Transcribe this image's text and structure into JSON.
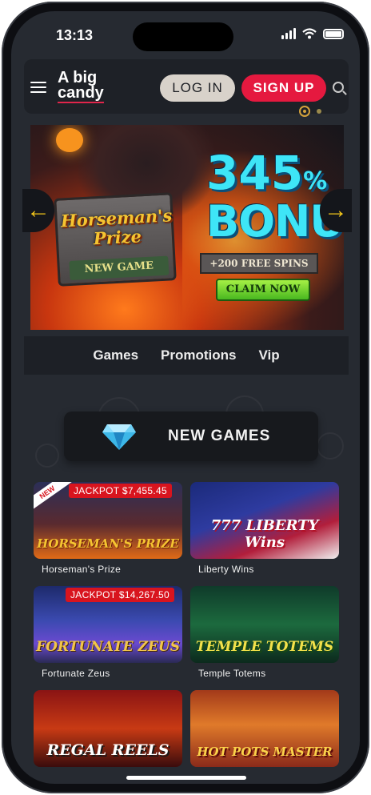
{
  "status_bar": {
    "time": "13:13"
  },
  "header": {
    "logo_line1": "A big",
    "logo_line2": "candy",
    "login_label": "LOG IN",
    "signup_label": "SIGN UP"
  },
  "banner": {
    "game_title": "Horseman's Prize",
    "game_tag": "NEW GAME",
    "bonus_percent": "345",
    "bonus_percent_sign": "%",
    "bonus_word": "BONUS",
    "free_spins": "+200 FREE SPINS",
    "cta_label": "CLAIM NOW",
    "arrow_left_glyph": "←",
    "arrow_right_glyph": "→"
  },
  "tabs": [
    {
      "label": "Games"
    },
    {
      "label": "Promotions"
    },
    {
      "label": "Vip"
    }
  ],
  "section": {
    "title": "NEW GAMES"
  },
  "games": [
    {
      "name": "Horseman's Prize",
      "thumb_text": "HORSEMAN'S PRIZE",
      "jackpot": "JACKPOT $7,455.45",
      "ribbon": "NEW"
    },
    {
      "name": "Liberty Wins",
      "thumb_text": "777 LIBERTY Wins",
      "jackpot": "",
      "ribbon": ""
    },
    {
      "name": "Fortunate Zeus",
      "thumb_text": "FORTUNATE ZEUS",
      "jackpot": "JACKPOT $14,267.50",
      "ribbon": ""
    },
    {
      "name": "Temple Totems",
      "thumb_text": "TEMPLE TOTEMS",
      "jackpot": "",
      "ribbon": ""
    },
    {
      "name": "",
      "thumb_text": "REGAL REELS",
      "jackpot": "",
      "ribbon": ""
    },
    {
      "name": "",
      "thumb_text": "HOT POTS MASTER",
      "jackpot": "",
      "ribbon": ""
    }
  ],
  "colors": {
    "accent_red": "#e5193f",
    "login_bg": "#d8d2ca",
    "screen_bg": "#262a31",
    "jackpot_red": "#d8141e"
  },
  "icons": {
    "menu": "hamburger-icon",
    "search": "search-icon",
    "gem": "diamond-icon"
  }
}
